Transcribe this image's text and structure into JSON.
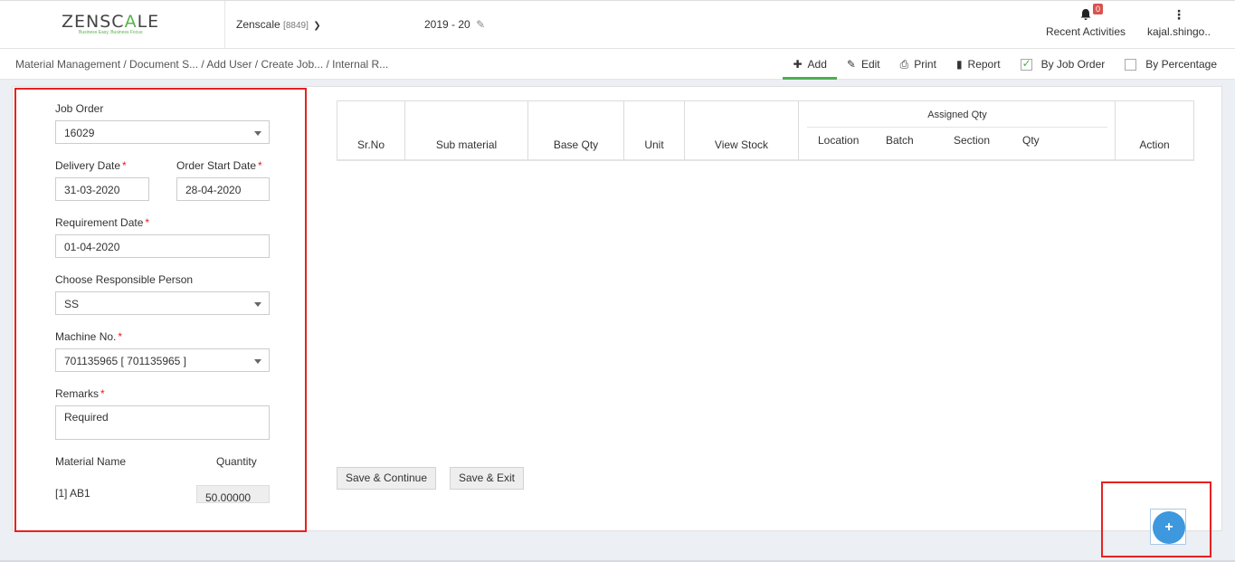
{
  "header": {
    "logo": "ZENSCALE",
    "logo_tagline": "Business Easy, Business Focus",
    "company_name": "Zenscale",
    "company_code": "[8849]",
    "fiscal_year": "2019 - 20",
    "notifications_count": "0",
    "recent_activities_label": "Recent Activities",
    "user_name": "kajal.shingo.."
  },
  "breadcrumb": "Material Management  / Document S... / Add User / Create Job... / Internal R...",
  "toolbar": {
    "add": "Add",
    "edit": "Edit",
    "print": "Print",
    "report": "Report",
    "by_job_order": "By Job Order",
    "by_percentage": "By Percentage"
  },
  "form": {
    "job_order_label": "Job Order",
    "job_order_value": "16029",
    "delivery_date_label": "Delivery Date",
    "delivery_date_value": "31-03-2020",
    "order_start_label": "Order Start Date",
    "order_start_value": "28-04-2020",
    "requirement_date_label": "Requirement Date",
    "requirement_date_value": "01-04-2020",
    "responsible_label": "Choose Responsible Person",
    "responsible_value": "SS",
    "machine_label": "Machine No.",
    "machine_value": "701135965 [ 701135965 ]",
    "remarks_label": "Remarks",
    "remarks_value": "Required",
    "material_name_label": "Material Name",
    "quantity_label": "Quantity",
    "material_item": "[1] AB1",
    "material_qty": "50.00000",
    "required_mark": "*"
  },
  "table": {
    "sr_no": "Sr.No",
    "sub_material": "Sub material",
    "base_qty": "Base Qty",
    "unit": "Unit",
    "view_stock": "View Stock",
    "assigned_qty": "Assigned Qty",
    "location": "Location",
    "batch": "Batch",
    "section": "Section",
    "qty": "Qty",
    "action": "Action"
  },
  "buttons": {
    "save_continue": "Save & Continue",
    "save_exit": "Save & Exit",
    "fab": "+"
  }
}
